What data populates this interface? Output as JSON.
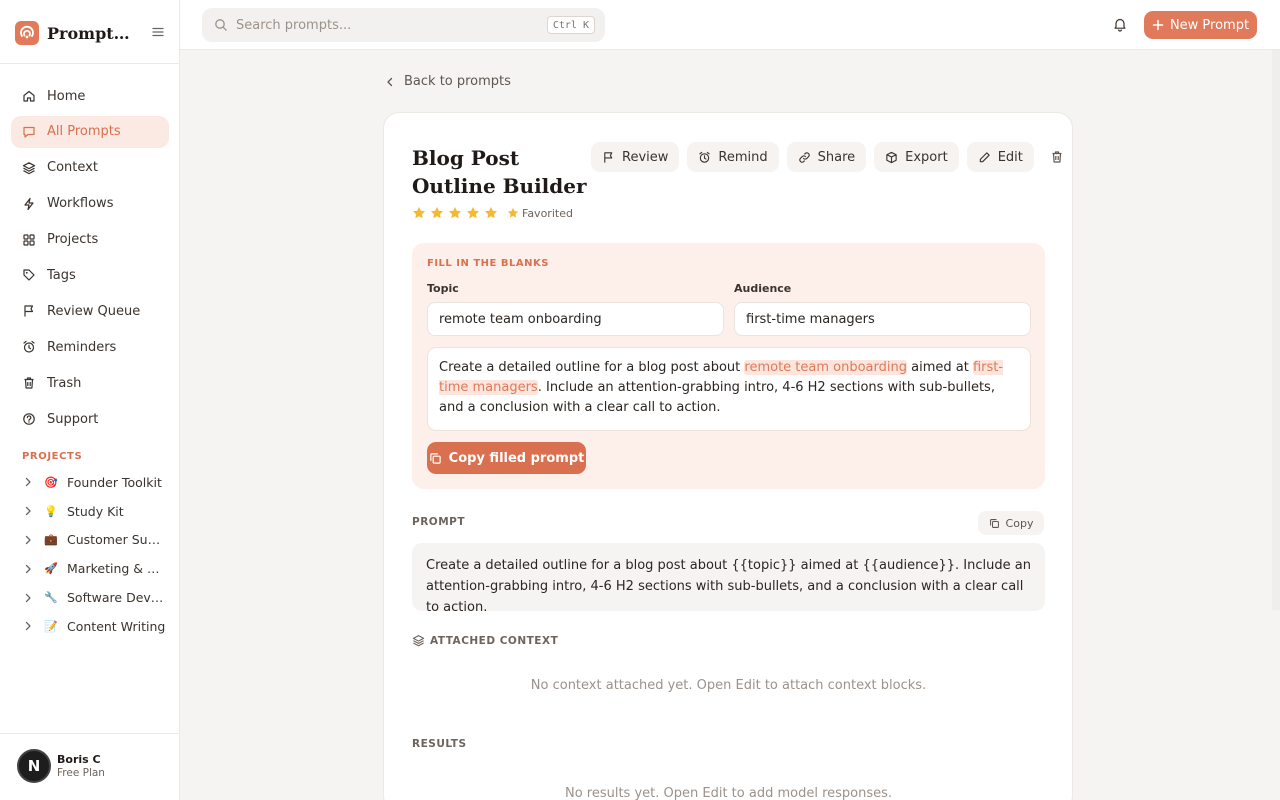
{
  "brand": {
    "name": "PromptA..."
  },
  "nav": [
    {
      "label": "Home",
      "icon": "home-icon"
    },
    {
      "label": "All Prompts",
      "icon": "message-icon",
      "active": true
    },
    {
      "label": "Context",
      "icon": "layers-icon"
    },
    {
      "label": "Workflows",
      "icon": "bolt-icon"
    },
    {
      "label": "Projects",
      "icon": "grid-icon"
    },
    {
      "label": "Tags",
      "icon": "tag-icon"
    },
    {
      "label": "Review Queue",
      "icon": "flag-icon"
    },
    {
      "label": "Reminders",
      "icon": "alarm-icon"
    },
    {
      "label": "Trash",
      "icon": "trash-icon"
    },
    {
      "label": "Support",
      "icon": "help-icon"
    }
  ],
  "projects": {
    "heading": "PROJECTS",
    "items": [
      {
        "emoji": "🎯",
        "name": "Founder Toolkit"
      },
      {
        "emoji": "💡",
        "name": "Study Kit"
      },
      {
        "emoji": "💼",
        "name": "Customer Sup..."
      },
      {
        "emoji": "🚀",
        "name": "Marketing & Gr..."
      },
      {
        "emoji": "🔧",
        "name": "Software Devel..."
      },
      {
        "emoji": "📝",
        "name": "Content Writing"
      }
    ]
  },
  "user": {
    "initial": "N",
    "name": "Boris C",
    "plan": "Free Plan"
  },
  "topbar": {
    "search_placeholder": "Search prompts...",
    "shortcut": "Ctrl K",
    "new_prompt": "New Prompt"
  },
  "main": {
    "back": "Back to prompts",
    "title": "Blog Post Outline Builder",
    "rating": 5,
    "favorited": "Favorited",
    "actions": [
      {
        "label": "Review",
        "icon": "flag-icon"
      },
      {
        "label": "Remind",
        "icon": "alarm-icon"
      },
      {
        "label": "Share",
        "icon": "link-icon"
      },
      {
        "label": "Export",
        "icon": "box-icon"
      },
      {
        "label": "Edit",
        "icon": "pencil-icon"
      }
    ],
    "blanks": {
      "heading": "FILL IN THE BLANKS",
      "topic_label": "Topic",
      "topic_value": "remote team onboarding",
      "audience_label": "Audience",
      "audience_value": "first-time managers",
      "preview_1": "Create a detailed outline for a blog post about ",
      "preview_2": " aimed at ",
      "preview_3": ". Include an attention-grabbing intro, 4-6 H2 sections with sub-bullets, and a conclusion with a clear call to action.",
      "copy_filled": "Copy filled prompt"
    },
    "prompt": {
      "heading": "PROMPT",
      "copy": "Copy",
      "text": "Create a detailed outline for a blog post about {{topic}} aimed at {{audience}}. Include an attention-grabbing intro, 4-6 H2 sections with sub-bullets, and a conclusion with a clear call to action."
    },
    "context": {
      "heading": "ATTACHED CONTEXT",
      "empty": "No context attached yet. Open Edit to attach context blocks."
    },
    "results": {
      "heading": "RESULTS",
      "empty": "No results yet. Open Edit to add model responses."
    }
  },
  "colors": {
    "accent": "#e07a5a",
    "accent_soft": "#fbe9e3",
    "star": "#f5b82e"
  }
}
